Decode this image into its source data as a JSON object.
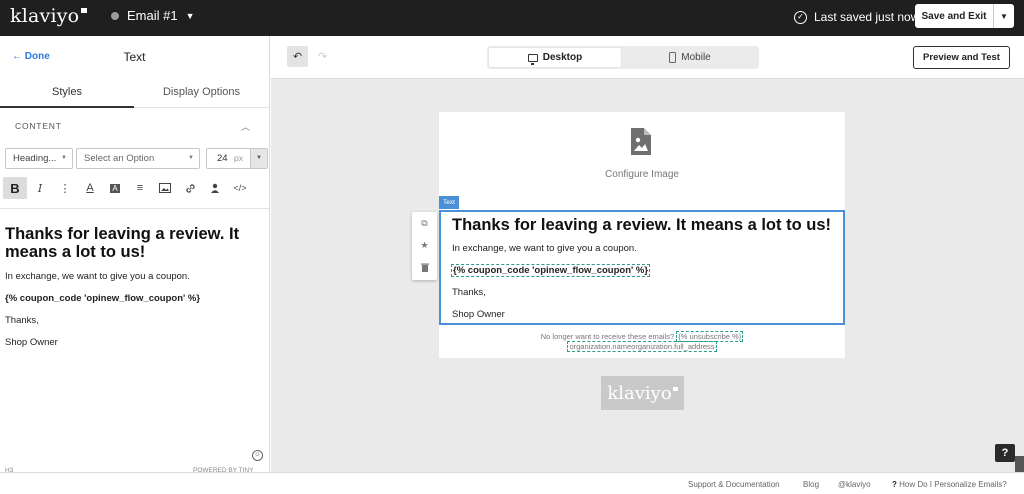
{
  "topbar": {
    "logo": "klaviyo",
    "email_name": "Email #1",
    "saved_status": "Last saved just now",
    "save_exit_label": "Save and Exit"
  },
  "left_panel": {
    "done_label": "Done",
    "title": "Text",
    "tabs": [
      "Styles",
      "Display Options"
    ],
    "section_label": "CONTENT",
    "block_format": "Heading...",
    "option_placeholder": "Select an Option",
    "font_size": "24",
    "font_size_unit": "px",
    "toolbar_icons": [
      "bold-icon",
      "italic-icon",
      "more-icon",
      "text-color-icon",
      "background-color-icon",
      "align-icon",
      "image-icon",
      "link-icon",
      "person-icon",
      "code-icon"
    ],
    "editor": {
      "heading": "Thanks for leaving a review. It means a lot to us!",
      "line1": "In exchange, we want to give you a coupon.",
      "code": "{% coupon_code 'opinew_flow_coupon' %}",
      "line2": "Thanks,",
      "line3": "Shop Owner"
    },
    "status_path": "H3",
    "powered_by": "POWERED BY TINY"
  },
  "canvas": {
    "view_modes": [
      "Desktop",
      "Mobile"
    ],
    "active_view": "Desktop",
    "preview_label": "Preview and Test",
    "image_block_label": "Configure Image",
    "text_block_tag": "Text",
    "text_block": {
      "heading": "Thanks for leaving a review. It means a lot to us!",
      "line1": "In exchange, we want to give you a coupon.",
      "code": "{% coupon_code 'opinew_flow_coupon' %}",
      "line2": "Thanks,",
      "line3": "Shop Owner"
    },
    "footer_line1_text": "No longer want to receive these emails?",
    "footer_line1_tag": "{% unsubscribe %}",
    "footer_line2": "organization.nameorganization.full_address",
    "brand_logo": "klaviyo",
    "help_label": "?"
  },
  "footer_links": [
    "Support & Documentation",
    "Blog",
    "@klaviyo",
    "How Do I Personalize Emails?"
  ],
  "colors": {
    "topbar_bg": "#1f1f1f",
    "link_blue": "#2d7be0",
    "selection_blue": "#4a90d9",
    "template_tag_dash": "#2a9d8f",
    "canvas_bg": "#eaeaea"
  }
}
